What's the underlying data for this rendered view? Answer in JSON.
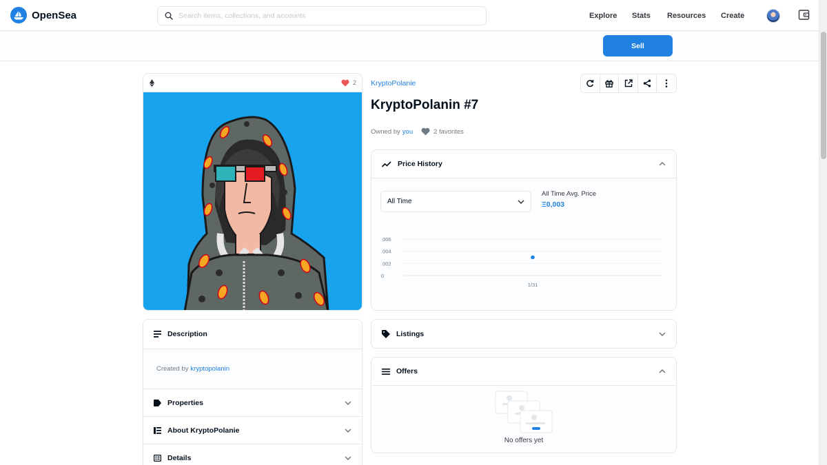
{
  "header": {
    "brand": "OpenSea",
    "search_placeholder": "Search items, collections, and accounts",
    "nav": [
      "Explore",
      "Stats",
      "Resources",
      "Create"
    ]
  },
  "actions": {
    "sell_label": "Sell"
  },
  "media": {
    "favorite_count": "2"
  },
  "asset": {
    "collection": "KryptoPolanie",
    "title": "KryptoPolanin #7",
    "owned_by_label": "Owned by",
    "owner": "you",
    "favorites": "2 favorites"
  },
  "description": {
    "title": "Description",
    "created_by_label": "Created by",
    "creator": "kryptopolanin"
  },
  "accordions": [
    {
      "label": "Properties"
    },
    {
      "label": "About KryptoPolanie"
    },
    {
      "label": "Details"
    }
  ],
  "price_history": {
    "title": "Price History",
    "range_select": "All Time",
    "avg_label": "All Time Avg. Price",
    "avg_value": "Ξ0,003"
  },
  "chart_data": {
    "type": "scatter",
    "title": "",
    "xlabel": "",
    "ylabel": "",
    "y_ticks": [
      ".006",
      ".004",
      ".002",
      "0"
    ],
    "ylim": [
      0,
      0.006
    ],
    "grid": true,
    "categories": [
      "1/31"
    ],
    "values": [
      0.003
    ]
  },
  "listings": {
    "title": "Listings"
  },
  "offers": {
    "title": "Offers",
    "empty_text": "No offers yet"
  },
  "colors": {
    "accent": "#2081e2",
    "heart": "#eb5757",
    "art_background": "#17a3ee"
  }
}
